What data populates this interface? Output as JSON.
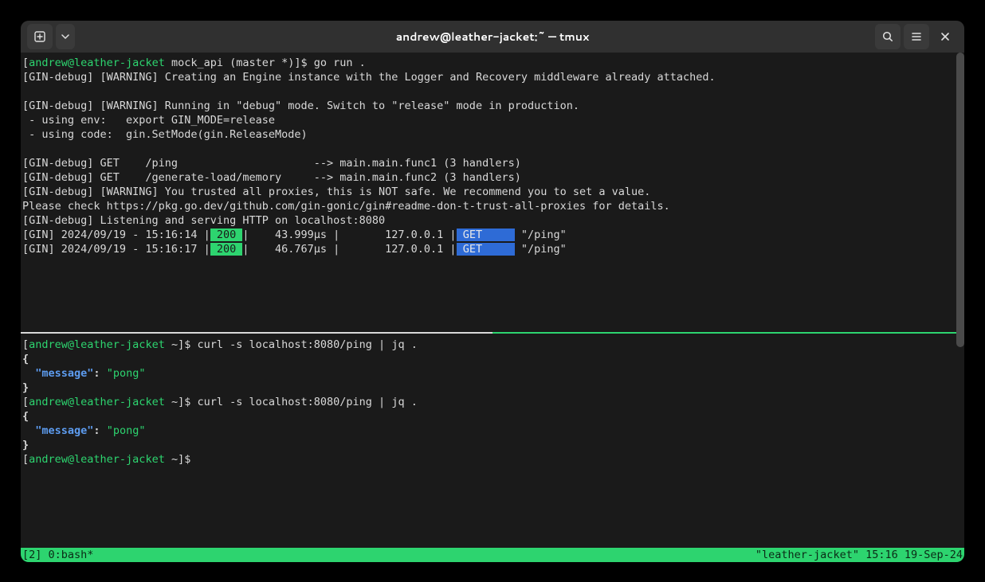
{
  "titlebar": {
    "title": "andrew@leather-jacket:~ — tmux"
  },
  "pane_top": {
    "prompt": {
      "bracket_open": "[",
      "user_host": "andrew@leather-jacket",
      "cwd": " mock_api (master *)",
      "bracket_close": "]$ ",
      "command": "go run ."
    },
    "lines": [
      "[GIN-debug] [WARNING] Creating an Engine instance with the Logger and Recovery middleware already attached.",
      "",
      "[GIN-debug] [WARNING] Running in \"debug\" mode. Switch to \"release\" mode in production.",
      " - using env:   export GIN_MODE=release",
      " - using code:  gin.SetMode(gin.ReleaseMode)",
      "",
      "[GIN-debug] GET    /ping                     --> main.main.func1 (3 handlers)",
      "[GIN-debug] GET    /generate-load/memory     --> main.main.func2 (3 handlers)",
      "[GIN-debug] [WARNING] You trusted all proxies, this is NOT safe. We recommend you to set a value.",
      "Please check https://pkg.go.dev/github.com/gin-gonic/gin#readme-don-t-trust-all-proxies for details.",
      "[GIN-debug] Listening and serving HTTP on localhost:8080"
    ],
    "reqs": [
      {
        "prefix": "[GIN] 2024/09/19 - 15:16:14 |",
        "status": " 200 ",
        "mid": "|    43.999µs |       127.0.0.1 |",
        "method": " GET     ",
        "path": " \"/ping\""
      },
      {
        "prefix": "[GIN] 2024/09/19 - 15:16:17 |",
        "status": " 200 ",
        "mid": "|    46.767µs |       127.0.0.1 |",
        "method": " GET     ",
        "path": " \"/ping\""
      }
    ]
  },
  "pane_bottom": {
    "prompt1": {
      "open": "[",
      "uh": "andrew@leather-jacket",
      "cwd": " ~",
      "close": "]$ ",
      "cmd": "curl -s localhost:8080/ping | jq ."
    },
    "json1": {
      "open": "{",
      "key": "\"message\"",
      "colon": ": ",
      "val": "\"pong\"",
      "close": "}"
    },
    "prompt2": {
      "open": "[",
      "uh": "andrew@leather-jacket",
      "cwd": " ~",
      "close": "]$ ",
      "cmd": "curl -s localhost:8080/ping | jq ."
    },
    "json2": {
      "open": "{",
      "key": "\"message\"",
      "colon": ": ",
      "val": "\"pong\"",
      "close": "}"
    },
    "prompt3": {
      "open": "[",
      "uh": "andrew@leather-jacket",
      "cwd": " ~",
      "close": "]$ ",
      "cmd": ""
    }
  },
  "tmux": {
    "left": "[2] 0:bash*",
    "right": "\"leather-jacket\" 15:16 19-Sep-24"
  }
}
